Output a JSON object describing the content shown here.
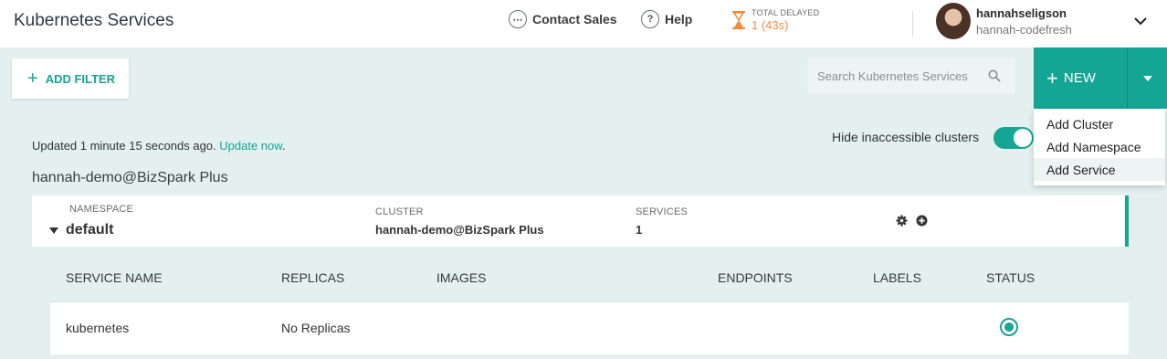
{
  "header": {
    "title": "Kubernetes Services",
    "contact_sales": "Contact Sales",
    "help": "Help",
    "delayed_label": "TOTAL DELAYED",
    "delayed_value": "1 (43s)",
    "user_name": "hannahseligson",
    "user_account": "hannah-codefresh"
  },
  "toolbar": {
    "add_filter": "ADD FILTER",
    "search_placeholder": "Search Kubernetes Services",
    "new_label": "NEW"
  },
  "dropdown": {
    "items": [
      "Add Cluster",
      "Add Namespace",
      "Add Service"
    ],
    "active_index": 2
  },
  "main": {
    "updated_text": "Updated 1 minute 15 seconds ago.",
    "update_link": "Update now",
    "updated_suffix": ".",
    "hide_label": "Hide inaccessible clusters",
    "hide_enabled": true,
    "cluster_title": "hannah-demo@BizSpark Plus"
  },
  "namespace": {
    "namespace_label": "NAMESPACE",
    "namespace_value": "default",
    "cluster_label": "CLUSTER",
    "cluster_value": "hannah-demo@BizSpark Plus",
    "services_label": "SERVICES",
    "services_value": "1"
  },
  "services_table": {
    "columns": [
      "SERVICE NAME",
      "REPLICAS",
      "IMAGES",
      "ENDPOINTS",
      "LABELS",
      "STATUS"
    ],
    "rows": [
      {
        "service_name": "kubernetes",
        "replicas": "No Replicas",
        "images": "",
        "endpoints": "",
        "labels": "",
        "status": "active"
      }
    ]
  },
  "colors": {
    "accent": "#14a594",
    "background": "#e3f0ef",
    "delayed": "#f28c3a"
  }
}
